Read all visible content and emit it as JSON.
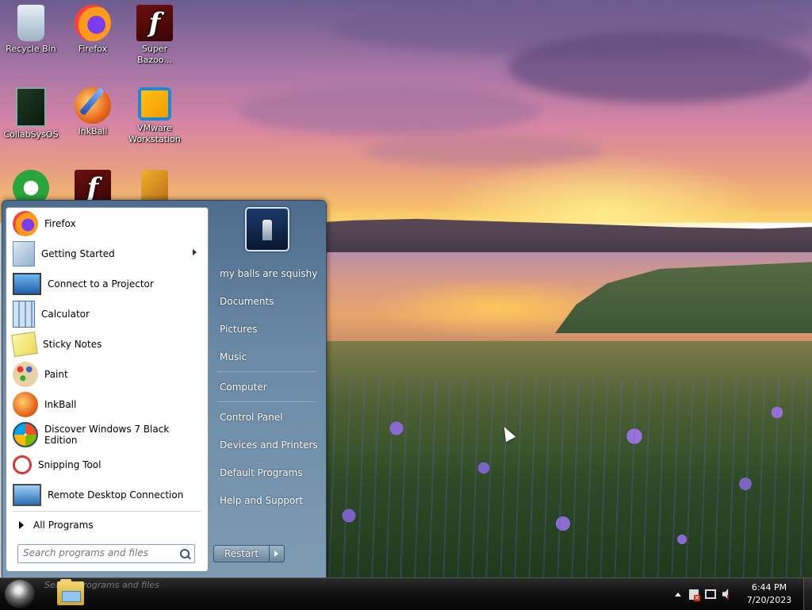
{
  "desktop": {
    "icons": [
      {
        "label": "Recycle Bin",
        "icon": "recycle-bin-icon"
      },
      {
        "label": "Firefox",
        "icon": "firefox-icon"
      },
      {
        "label": "Super Bazoo...",
        "icon": "flash-icon"
      },
      {
        "label": "CollabSysOS",
        "icon": "collabsysos-icon"
      },
      {
        "label": "InkBall",
        "icon": "inkball-icon"
      },
      {
        "label": "VMware Workstation",
        "icon": "vmware-icon"
      },
      {
        "label": "",
        "icon": "utorrent-icon"
      },
      {
        "label": "",
        "icon": "flash-icon"
      },
      {
        "label": "",
        "icon": "blocks-game-icon"
      }
    ]
  },
  "start_menu": {
    "programs": [
      {
        "label": "Firefox",
        "icon": "firefox-icon"
      },
      {
        "label": "Getting Started",
        "icon": "getting-started-icon",
        "has_submenu": true
      },
      {
        "label": "Connect to a Projector",
        "icon": "projector-icon"
      },
      {
        "label": "Calculator",
        "icon": "calculator-icon"
      },
      {
        "label": "Sticky Notes",
        "icon": "sticky-notes-icon"
      },
      {
        "label": "Paint",
        "icon": "paint-icon"
      },
      {
        "label": "InkBall",
        "icon": "inkball-icon"
      },
      {
        "label": "Discover Windows 7 Black Edition",
        "icon": "windows-logo-icon"
      },
      {
        "label": "Snipping Tool",
        "icon": "snipping-tool-icon"
      },
      {
        "label": "Remote Desktop Connection",
        "icon": "remote-desktop-icon"
      }
    ],
    "all_programs_label": "All Programs",
    "search_placeholder": "Search programs and files",
    "right_items": [
      {
        "label": "my balls are squishy"
      },
      {
        "label": "Documents"
      },
      {
        "label": "Pictures"
      },
      {
        "label": "Music"
      },
      {
        "label": "Computer"
      },
      {
        "label": "Control Panel"
      },
      {
        "label": "Devices and Printers"
      },
      {
        "label": "Default Programs"
      },
      {
        "label": "Help and Support"
      }
    ],
    "power_button_label": "Restart"
  },
  "taskbar": {
    "ghost_search_text": "Search programs and files",
    "clock_time": "6:44 PM",
    "clock_date": "7/20/2023",
    "tray_icons": [
      "show-hidden-icons-icon",
      "action-center-icon",
      "network-icon",
      "volume-muted-icon"
    ]
  }
}
